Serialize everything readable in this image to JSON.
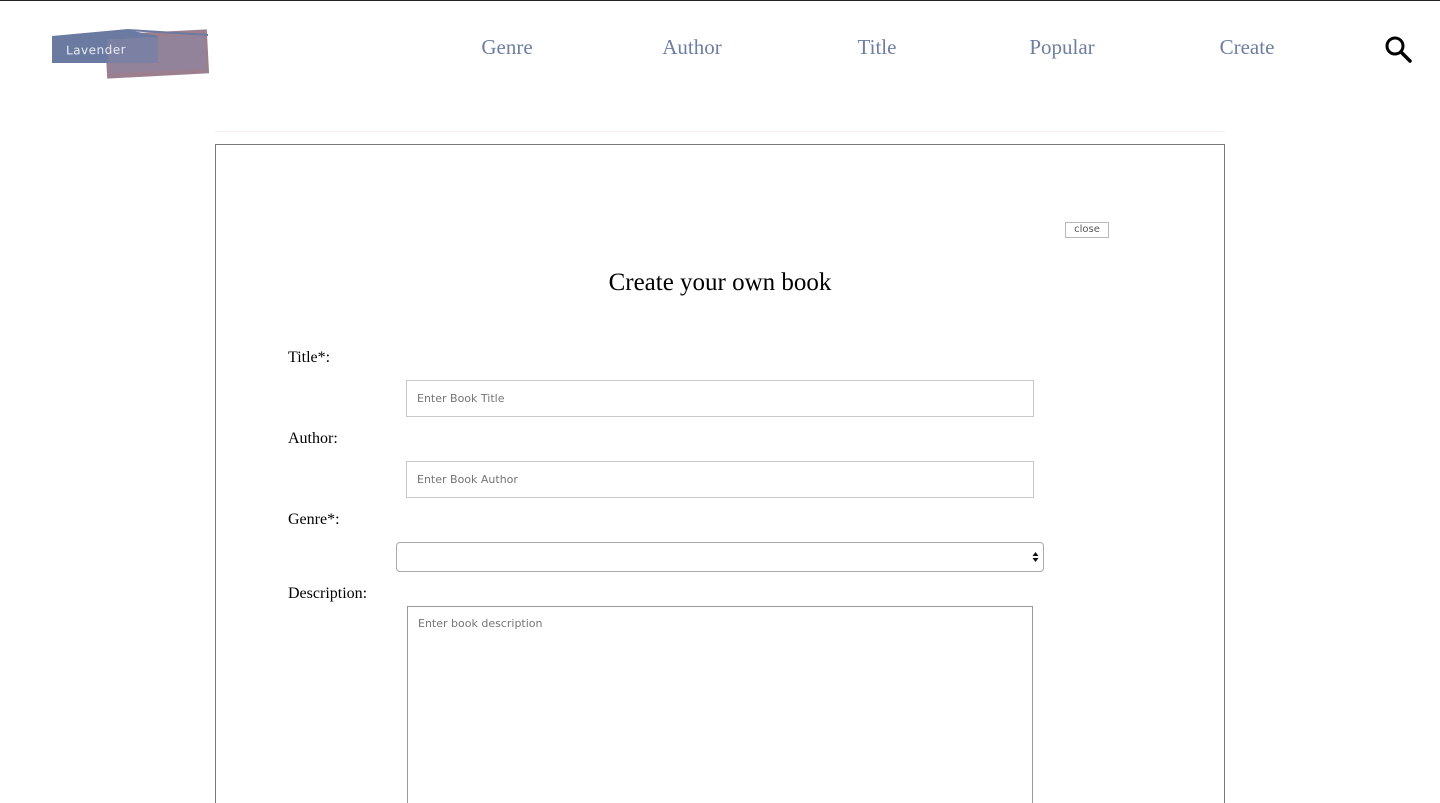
{
  "header": {
    "logo_text": "Lavender",
    "nav": [
      {
        "label": "Genre"
      },
      {
        "label": "Author"
      },
      {
        "label": "Title"
      },
      {
        "label": "Popular"
      },
      {
        "label": "Create"
      }
    ],
    "search_icon": "search-icon"
  },
  "modal": {
    "close_label": "close",
    "title": "Create your own book",
    "fields": {
      "title": {
        "label": "Title*:",
        "placeholder": "Enter Book Title",
        "value": ""
      },
      "author": {
        "label": "Author:",
        "placeholder": "Enter Book Author",
        "value": ""
      },
      "genre": {
        "label": "Genre*:",
        "selected": ""
      },
      "description": {
        "label": "Description:",
        "placeholder": "Enter book description",
        "value": ""
      }
    }
  },
  "colors": {
    "nav_text": "#6f7ea0",
    "logo_blue": "#6b7aa1",
    "logo_mauve": "#9c7f8f"
  }
}
